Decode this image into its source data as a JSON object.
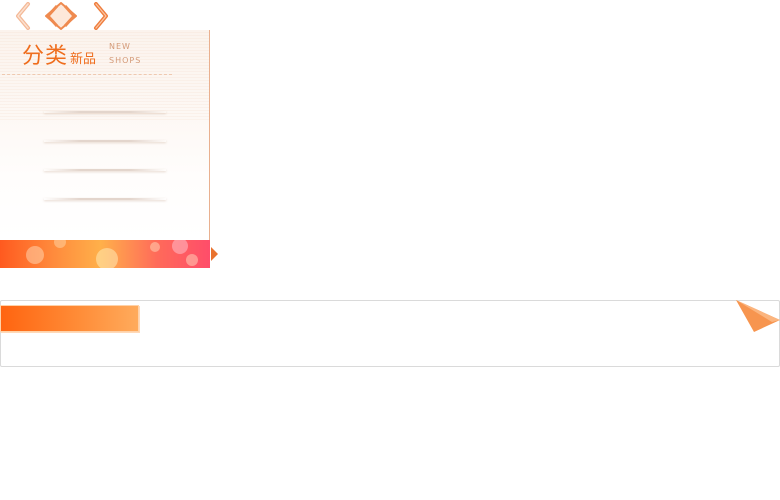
{
  "nav": {
    "prev_icon": "chevron-left-icon",
    "center_icon": "diamond-arrows-icon",
    "next_icon": "chevron-right-icon"
  },
  "category_panel": {
    "title_main": "分类",
    "title_sub": "新品",
    "en_line1": "NEW",
    "en_line2": "SHOPS",
    "items": [
      "",
      "",
      "",
      ""
    ]
  },
  "bar": {
    "tab_label": ""
  },
  "colors": {
    "accent": "#ef6d1d",
    "arrow": "#ef8a4f",
    "banner_start": "#ff5a1f",
    "banner_end": "#ff4d6a",
    "bar_tab": "#ff7a25",
    "corner": "#f7954f"
  }
}
